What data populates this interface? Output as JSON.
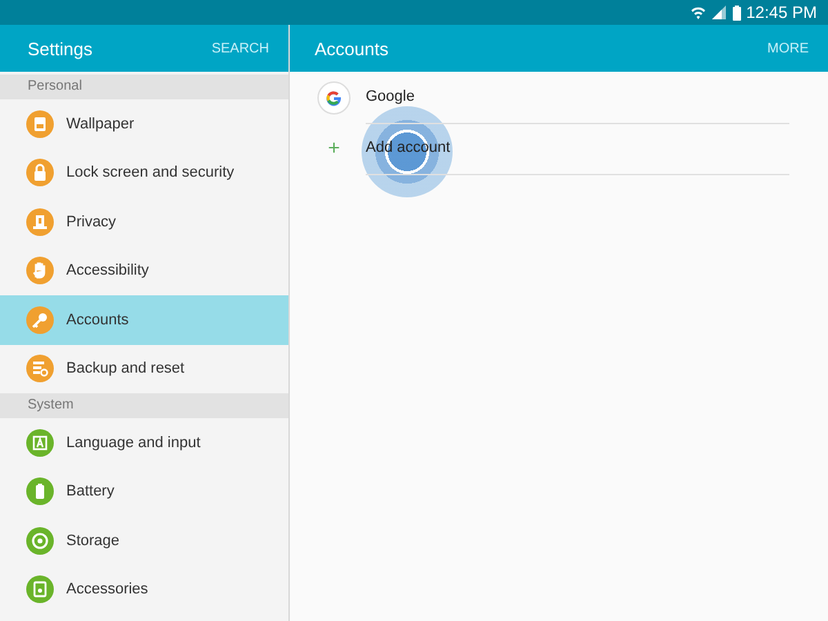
{
  "status_bar": {
    "time": "12:45 PM"
  },
  "sidebar": {
    "title": "Settings",
    "action": "SEARCH",
    "sections": [
      {
        "header": "Personal",
        "items": [
          {
            "label": "Wallpaper",
            "kind": "wallpaper",
            "color": "#f0a030",
            "selected": false
          },
          {
            "label": "Lock screen and security",
            "kind": "lock",
            "color": "#f0a030",
            "selected": false
          },
          {
            "label": "Privacy",
            "kind": "privacy",
            "color": "#f0a030",
            "selected": false
          },
          {
            "label": "Accessibility",
            "kind": "hand",
            "color": "#f0a030",
            "selected": false
          },
          {
            "label": "Accounts",
            "kind": "key",
            "color": "#f0a030",
            "selected": true
          },
          {
            "label": "Backup and reset",
            "kind": "backup",
            "color": "#f0a030",
            "selected": false
          }
        ]
      },
      {
        "header": "System",
        "items": [
          {
            "label": "Language and input",
            "kind": "language",
            "color": "#6ab42a",
            "selected": false
          },
          {
            "label": "Battery",
            "kind": "battery",
            "color": "#6ab42a",
            "selected": false
          },
          {
            "label": "Storage",
            "kind": "storage",
            "color": "#6ab42a",
            "selected": false
          },
          {
            "label": "Accessories",
            "kind": "accessories",
            "color": "#6ab42a",
            "selected": false
          }
        ]
      }
    ]
  },
  "main": {
    "title": "Accounts",
    "action": "MORE",
    "items": [
      {
        "kind": "account",
        "label": "Google"
      },
      {
        "kind": "add",
        "label": "Add account",
        "icon": "+"
      }
    ],
    "touch_indicator": true
  }
}
